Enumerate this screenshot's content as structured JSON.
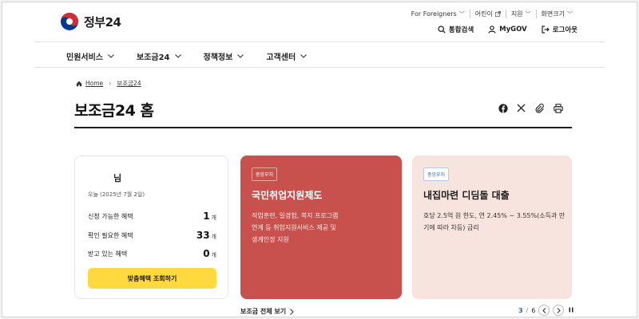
{
  "header": {
    "logo_text": "정부24",
    "utility": [
      {
        "label": "For Foreigners",
        "icon": "chevron-down-icon"
      },
      {
        "label": "어린이",
        "icon": "external-link-icon"
      },
      {
        "label": "지원",
        "icon": "chevron-down-icon"
      },
      {
        "label": "화면크기",
        "icon": "chevron-down-icon"
      }
    ],
    "actions": [
      {
        "label": "통합검색",
        "icon": "search-icon"
      },
      {
        "label": "MyGOV",
        "icon": "user-icon"
      },
      {
        "label": "로그아웃",
        "icon": "logout-icon"
      }
    ]
  },
  "nav": [
    {
      "label": "민원서비스"
    },
    {
      "label": "보조금24"
    },
    {
      "label": "정책정보"
    },
    {
      "label": "고객센터"
    }
  ],
  "breadcrumb": {
    "home": "Home",
    "current": "보조금24"
  },
  "page": {
    "title": "보조금24 홈"
  },
  "share_tools": [
    "facebook-icon",
    "x-icon",
    "link-icon",
    "print-icon"
  ],
  "profile": {
    "name": "님",
    "date": "오늘 (2025년 7월 2일)",
    "rows": [
      {
        "label": "신청 가능한 혜택",
        "count": "1",
        "unit": "개"
      },
      {
        "label": "확인 필요한 혜택",
        "count": "33",
        "unit": "개"
      },
      {
        "label": "받고 있는 혜택",
        "count": "0",
        "unit": "개"
      }
    ],
    "button": "맞춤혜택 조회하기"
  },
  "cards": [
    {
      "badge": "중앙부처",
      "title": "국민취업지원제도",
      "desc": "직업훈련, 일경험, 복지 프로그램 연계 등 취업지원서비스 제공 및 생계안정 지원",
      "color": "#c8514e"
    },
    {
      "badge": "중앙부처",
      "title": "내집마련 디딤돌 대출",
      "desc": "호당 2.5억 원 한도, 연 2.45% ~ 3.55%(소득과 만기에 따라 차등) 금리",
      "color": "#f7e4df"
    }
  ],
  "slider": {
    "view_all": "보조금 전체 보기",
    "current": "3",
    "separator": "/",
    "total": "6"
  },
  "colors": {
    "brand_blue": "#003a8c",
    "brand_red": "#cd2e3a",
    "accent_yellow": "#ffd93d",
    "pager_blue": "#2a63c9"
  }
}
